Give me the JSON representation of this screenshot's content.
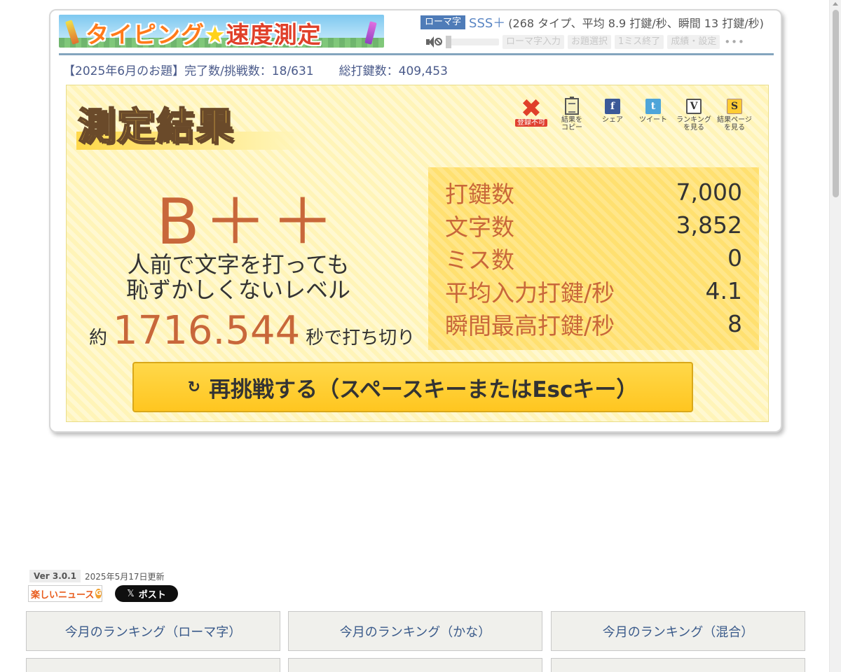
{
  "header": {
    "logo_text_1": "タイピング",
    "logo_star": "★",
    "logo_text_2": "速度測定",
    "mode_badge": "ローマ字",
    "rank": "SSS＋",
    "rank_detail": "(268 タイプ、平均 8.9 打鍵/秒、瞬間 13 打鍵/秒)"
  },
  "toolbar": {
    "speaker_icon": "speaker-muted-icon",
    "buttons": [
      "ローマ字入力",
      "お題選択",
      "1ミス終了",
      "成績・設定"
    ],
    "more": "•••"
  },
  "info": {
    "challenge": "【2025年6月のお題】完了数/挑戦数：18/631",
    "total_keys": "総打鍵数：409,453"
  },
  "result": {
    "title": "測定結果",
    "grade": "B＋＋",
    "level_desc_1": "人前で文字を打っても",
    "level_desc_2": "恥ずかしくないレベル",
    "time_prefix": "約",
    "time_value": "1716.544",
    "time_suffix": "秒で打ち切り",
    "icons": [
      {
        "name": "not-registrable-icon",
        "glyph": "✖",
        "caption": "登録不可"
      },
      {
        "name": "copy-result-icon",
        "glyph": "",
        "caption": "結果を\nコピー"
      },
      {
        "name": "facebook-share-icon",
        "glyph": "f",
        "caption": "シェア"
      },
      {
        "name": "tweet-icon",
        "glyph": "t",
        "caption": "ツイート"
      },
      {
        "name": "ranking-icon",
        "glyph": "V",
        "caption": "ランキング\nを見る"
      },
      {
        "name": "result-page-icon",
        "glyph": "S",
        "caption": "結果ページ\nを見る"
      }
    ],
    "stats": [
      {
        "label": "打鍵数",
        "value": "7,000"
      },
      {
        "label": "文字数",
        "value": "3,852"
      },
      {
        "label": "ミス数",
        "value": "0"
      },
      {
        "label": "平均入力打鍵/秒",
        "value": "4.1"
      },
      {
        "label": "瞬間最高打鍵/秒",
        "value": "8"
      }
    ],
    "retry_icon": "↻",
    "retry_label": "再挑戦する（スペースキーまたはEscキー）"
  },
  "footer": {
    "version": "Ver 3.0.1",
    "updated": "2025年5月17日更新",
    "news_logo": "楽しいニュース",
    "news_logo_mark": "G",
    "x_post": "ポスト",
    "x_mark": "𝕏",
    "ranking_buttons": [
      "今月のランキング（ローマ字）",
      "今月のランキング（かな）",
      "今月のランキング（混合）",
      "",
      "",
      ""
    ]
  },
  "colors": {
    "accent_orange": "#c8673a",
    "panel_yellow": "#fff4b8",
    "stats_yellow": "#ffe070",
    "button_yellow": "#ffc620",
    "link_blue": "#3a5a8a"
  }
}
